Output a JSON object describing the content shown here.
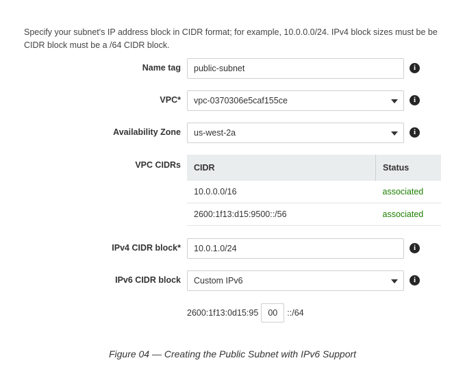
{
  "intro": {
    "line1": "Specify your subnet's IP address block in CIDR format; for example, 10.0.0.0/24. IPv4 block sizes must be be",
    "line2": "CIDR block must be a /64 CIDR block."
  },
  "form": {
    "name_tag": {
      "label": "Name tag",
      "value": "public-subnet"
    },
    "vpc": {
      "label": "VPC*",
      "value": "vpc-0370306e5caf155ce"
    },
    "az": {
      "label": "Availability Zone",
      "value": "us-west-2a"
    },
    "vpc_cidrs": {
      "label": "VPC CIDRs",
      "columns": [
        "CIDR",
        "Status"
      ],
      "rows": [
        {
          "cidr": "10.0.0.0/16",
          "status": "associated"
        },
        {
          "cidr": "2600:1f13:d15:9500::/56",
          "status": "associated"
        }
      ]
    },
    "ipv4": {
      "label": "IPv4 CIDR block*",
      "value": "10.0.1.0/24"
    },
    "ipv6": {
      "label": "IPv6 CIDR block",
      "value": "Custom IPv6",
      "prefix": "2600:1f13:0d15:95",
      "octet": "00",
      "suffix": "::/64"
    }
  },
  "info_icon": "i",
  "caption": "Figure 04 — Creating the Public Subnet with IPv6 Support",
  "colors": {
    "associated": "#1d8102",
    "table_header_bg": "#eaeded"
  }
}
